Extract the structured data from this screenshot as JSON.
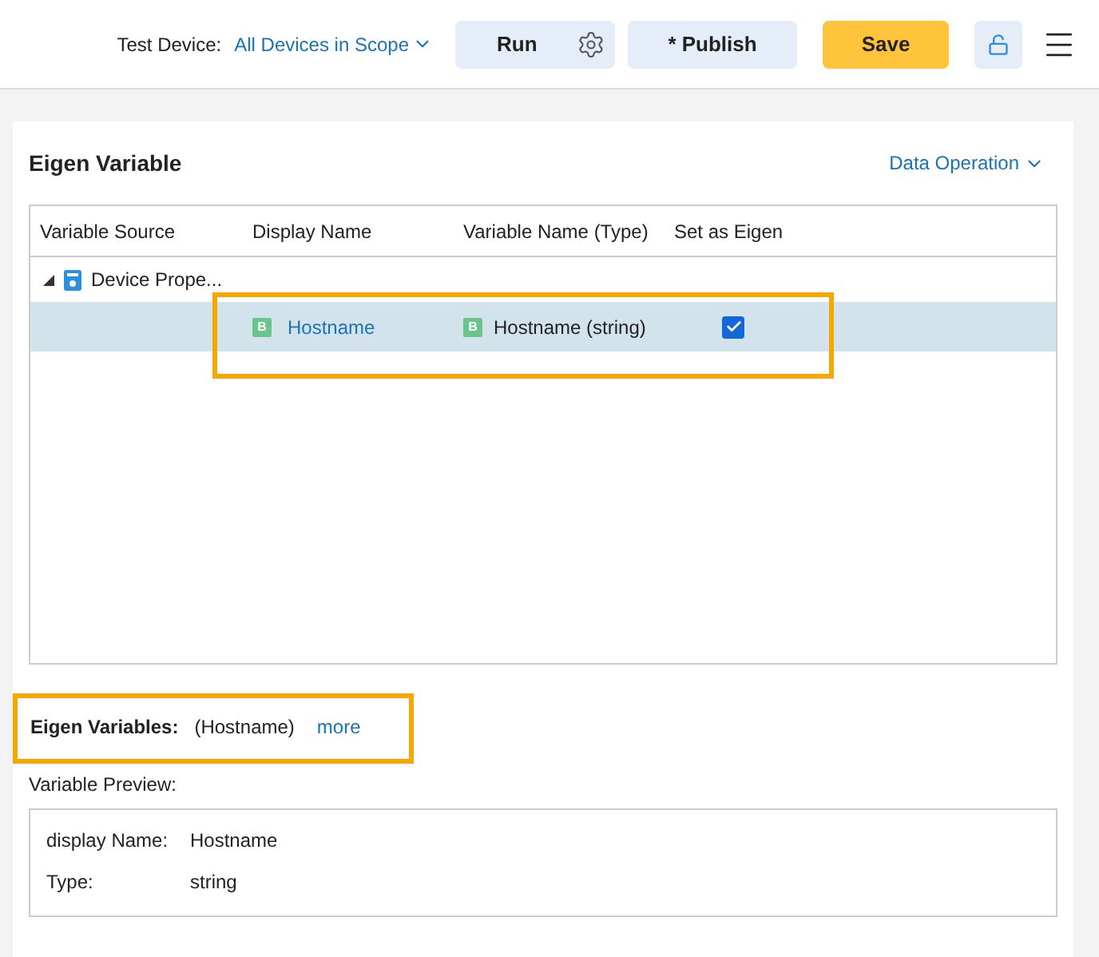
{
  "toolbar": {
    "test_device_label": "Test Device:",
    "test_device_value": "All Devices in Scope",
    "run": "Run",
    "publish": "* Publish",
    "save": "Save"
  },
  "panel": {
    "title": "Eigen Variable",
    "data_operation": "Data Operation"
  },
  "table": {
    "columns": [
      "Variable Source",
      "Display Name",
      "Variable Name (Type)",
      "Set as Eigen"
    ],
    "groups": [
      {
        "source": "Device Prope...",
        "expanded": true,
        "children": [
          {
            "badge": "B",
            "display_name": "Hostname",
            "variable_badge": "B",
            "variable_name": "Hostname (string)",
            "set_as_eigen": true,
            "selected": true
          }
        ]
      }
    ]
  },
  "eigen_variables": {
    "label": "Eigen Variables:",
    "value": "(Hostname)",
    "more": "more"
  },
  "preview": {
    "label": "Variable Preview:",
    "rows": [
      {
        "key": "display Name:",
        "value": "Hostname"
      },
      {
        "key": "Type:",
        "value": "string"
      }
    ]
  }
}
